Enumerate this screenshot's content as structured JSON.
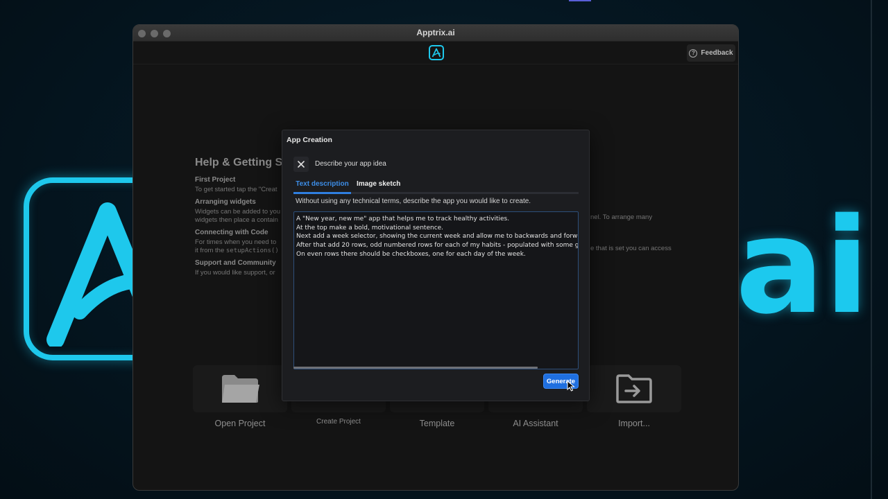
{
  "window": {
    "title": "Apptrix.ai"
  },
  "toolbar": {
    "logo_icon": "apptrix-logo-icon",
    "feedback_label": "Feedback",
    "feedback_icon": "help-circle-icon"
  },
  "background": {
    "brand_text": "ai",
    "accent_color": "#1ec8ec"
  },
  "help": {
    "title": "Help & Getting S",
    "sections": [
      {
        "heading": "First Project",
        "text": "To get started tap the \"Creat"
      },
      {
        "heading": "Arranging widgets",
        "text": "Widgets can be added to you",
        "text2": "widgets then place a contain",
        "text_right": "nel. To arrange many"
      },
      {
        "heading": "Connecting with Code",
        "text": "For times when you need to",
        "text2": "it from the ",
        "code": "setupActions()",
        "text_right": "e that is set you can access"
      },
      {
        "heading": "Support and Community",
        "text": "If you would like support, or"
      }
    ]
  },
  "tiles": [
    {
      "label": "Open Project",
      "icon": "folder-icon"
    },
    {
      "label": "Create Project",
      "icon": "new-project-icon"
    },
    {
      "label": "Template",
      "icon": "template-icon"
    },
    {
      "label": "AI Assistant",
      "icon": "ai-assistant-icon"
    },
    {
      "label": "Import...",
      "icon": "import-icon"
    }
  ],
  "modal": {
    "title": "App Creation",
    "subtitle": "Describe your app idea",
    "tabs": [
      "Text description",
      "Image sketch"
    ],
    "active_tab": "Text description",
    "instruction": "Without using any technical terms, describe the app you would like to create.",
    "description_text": "A \"New year, new me\" app that helps me to track healthy activities.\nAt the top make a bold, motivational sentence.\nNext add a week selector, showing the current week and allow me to backwards and forward\nAfter that add 20 rows, odd numbered rows for each of my habits - populated with some gre\nOn even rows there should be checkboxes, one for each day of the week.",
    "generate_label": "Generate",
    "accent_color": "#1f6fe0"
  }
}
